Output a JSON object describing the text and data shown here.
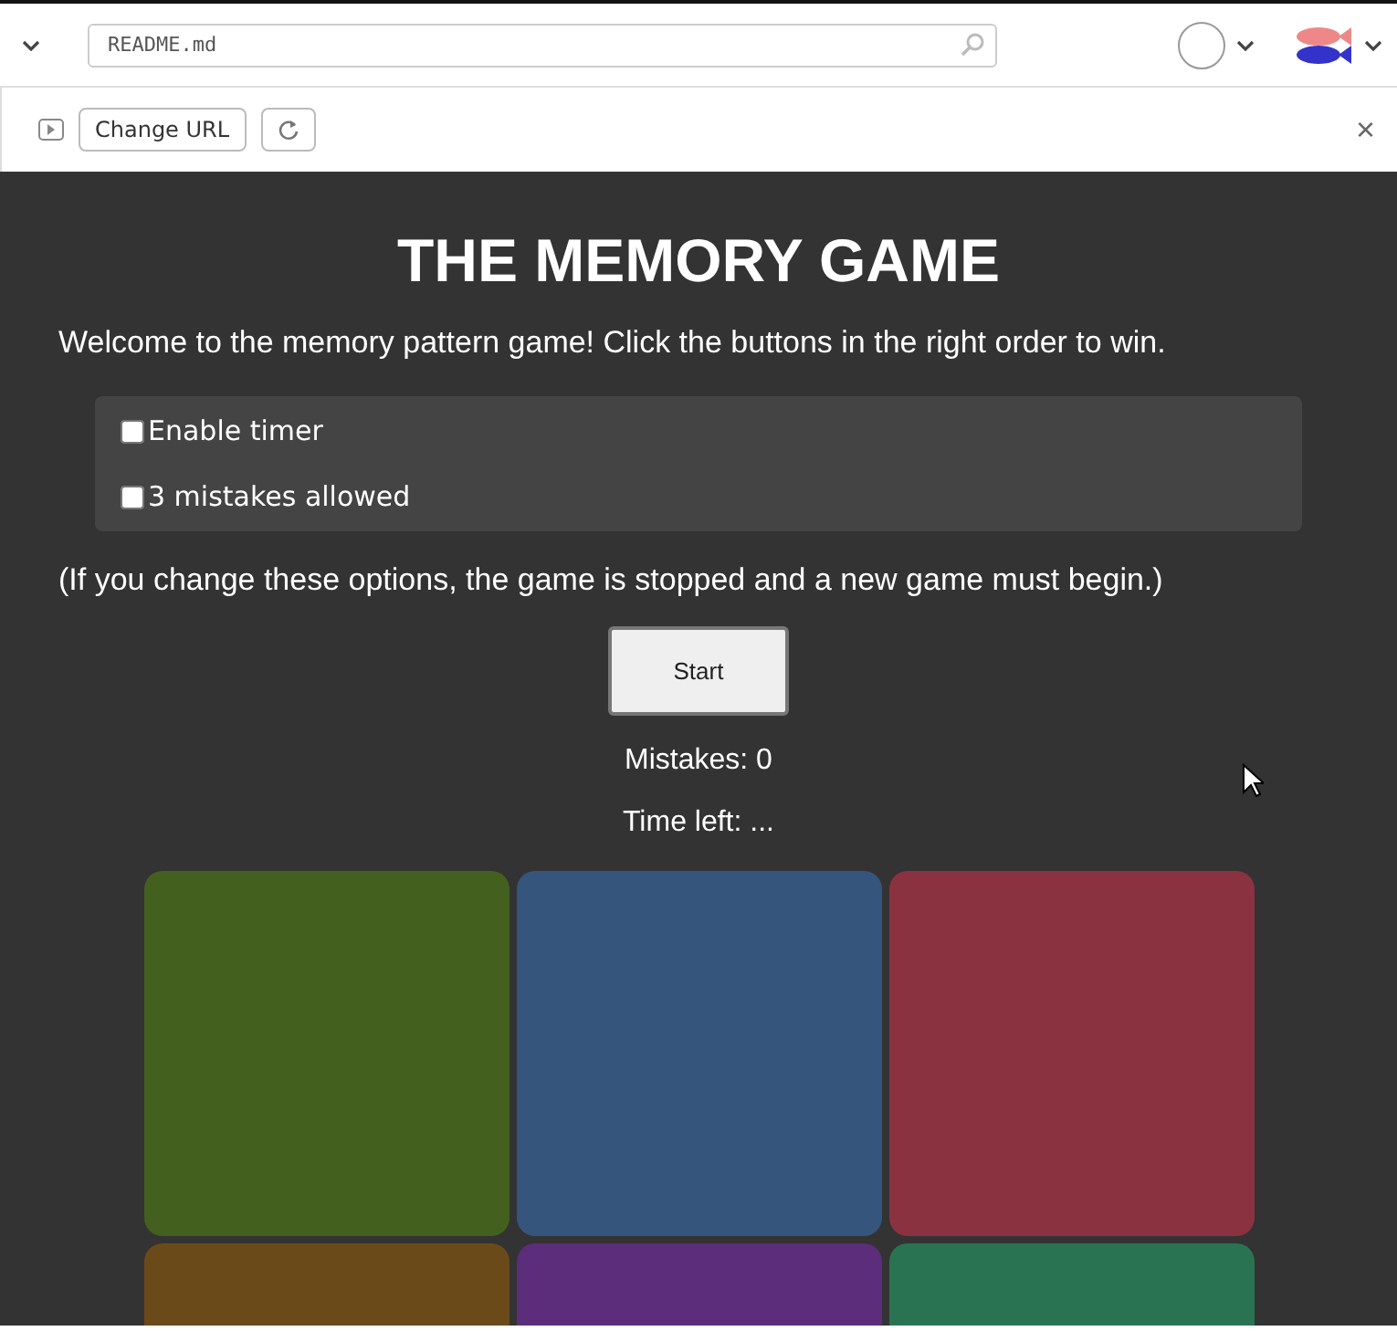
{
  "topbar": {
    "search": {
      "value": "README.md"
    }
  },
  "preview_bar": {
    "change_url": "Change URL",
    "close": "×"
  },
  "game": {
    "title": "THE MEMORY GAME",
    "intro": "Welcome to the memory pattern game! Click the buttons in the right order to win.",
    "options": [
      {
        "label": "Enable timer",
        "checked": false
      },
      {
        "label": "3 mistakes allowed",
        "checked": false
      }
    ],
    "note": "(If you change these options, the game is stopped and a new game must begin.)",
    "start": "Start",
    "mistakes": "Mistakes: 0",
    "time_left": "Time left: ...",
    "tiles": [
      {
        "color": "#44601f"
      },
      {
        "color": "#36557c"
      },
      {
        "color": "#8b3241"
      },
      {
        "color": "#6b4a1a"
      },
      {
        "color": "#5b2d7a"
      },
      {
        "color": "#2a7352"
      }
    ]
  }
}
